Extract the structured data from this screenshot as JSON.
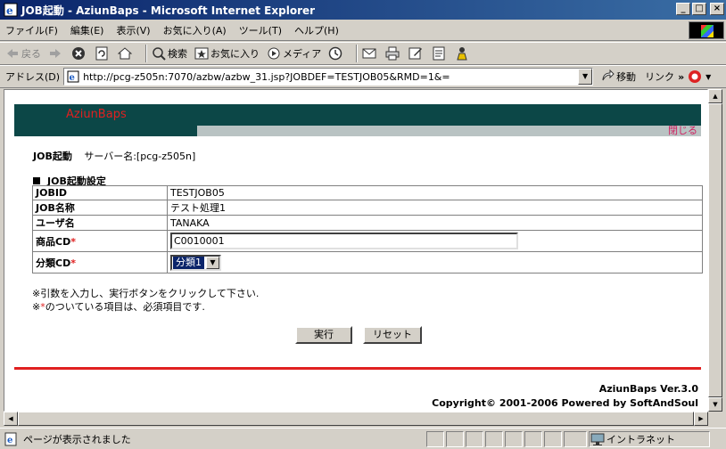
{
  "window": {
    "title": "JOB起動 - AziunBaps - Microsoft Internet Explorer",
    "min": "_",
    "max": "□",
    "close": "×"
  },
  "menu": [
    "ファイル(F)",
    "編集(E)",
    "表示(V)",
    "お気に入り(A)",
    "ツール(T)",
    "ヘルプ(H)"
  ],
  "toolbar": {
    "back": "戻る",
    "search": "検索",
    "favorites": "お気に入り",
    "media": "メディア"
  },
  "address": {
    "label": "アドレス(D)",
    "url": "http://pcg-z505n:7070/azbw/azbw_31.jsp?JOBDEF=TESTJOB05&RMD=1&=",
    "go": "移動",
    "links": "リンク"
  },
  "page": {
    "brand": "AziunBaps",
    "close_link": "閉じる",
    "heading": "JOB起動",
    "server_label": "サーバー名:[pcg-z505n]",
    "section_title": "JOB起動設定",
    "rows": {
      "jobid_label": "JOBID",
      "jobid_value": "TESTJOB05",
      "jobname_label": "JOB名称",
      "jobname_value": "テスト処理1",
      "user_label": "ユーザ名",
      "user_value": "TANAKA",
      "product_label": "商品CD",
      "product_value": "C0010001",
      "category_label": "分類CD",
      "category_value": "分類1"
    },
    "required_mark": "*",
    "note1": "※引数を入力し、実行ボタンをクリックして下さい.",
    "note2_prefix": "※",
    "note2_suffix": "のついている項目は、必須項目です.",
    "exec_button": "実行",
    "reset_button": "リセット",
    "footer_version": "AziunBaps Ver.3.0",
    "footer_copyright": "Copyright© 2001-2006 Powered by SoftAndSoul"
  },
  "status": {
    "text": "ページが表示されました",
    "zone": "イントラネット"
  }
}
